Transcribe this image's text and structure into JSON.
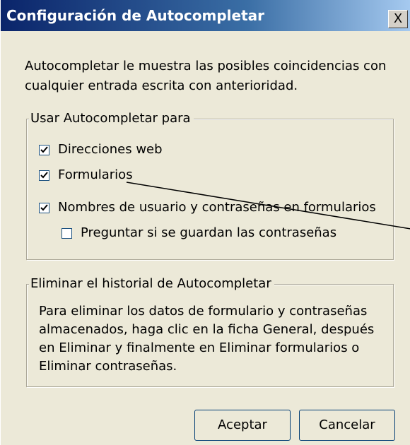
{
  "window": {
    "title": "Configuración de Autocompletar",
    "close_label": "X"
  },
  "description": "Autocompletar le muestra las posibles coincidencias con cualquier entrada escrita con anterioridad.",
  "group_use": {
    "legend": "Usar Autocompletar para",
    "items": [
      {
        "label": "Direcciones web",
        "checked": true
      },
      {
        "label": "Formularios",
        "checked": true
      },
      {
        "label": "Nombres de usuario y contraseñas en formularios",
        "checked": true
      },
      {
        "label": "Preguntar si se guardan las contraseñas",
        "checked": false
      }
    ]
  },
  "group_delete": {
    "legend": "Eliminar el historial de Autocompletar",
    "text": "Para eliminar los datos de formulario y contraseñas almacenados, haga clic en la ficha General, después en Eliminar y finalmente en Eliminar formularios o Eliminar contraseñas."
  },
  "buttons": {
    "ok": "Aceptar",
    "cancel": "Cancelar"
  },
  "colors": {
    "title_bar": "#0a246a",
    "dialog_bg": "#ece9d8",
    "checkbox_border": "#1c5180"
  }
}
